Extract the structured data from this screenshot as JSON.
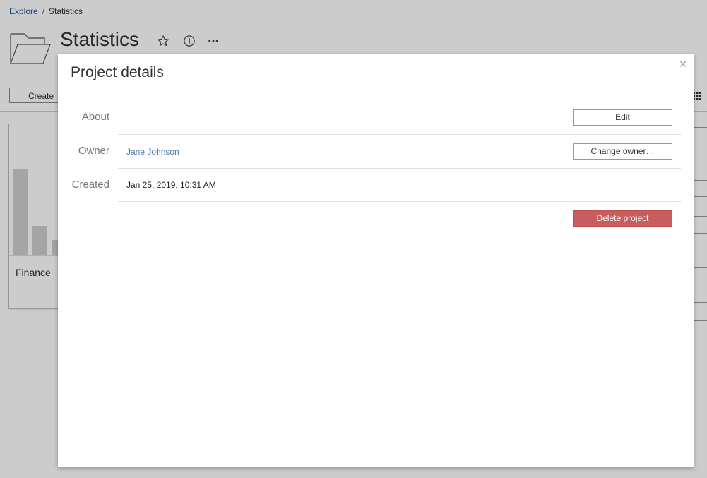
{
  "breadcrumb": {
    "root": "Explore",
    "separator": "/",
    "current": "Statistics"
  },
  "page": {
    "title": "Statistics"
  },
  "toolbar": {
    "create_label": "Create"
  },
  "cards": [
    {
      "label": "Finance"
    }
  ],
  "modal": {
    "title": "Project details",
    "close_glyph": "×",
    "about_label": "About",
    "owner_label": "Owner",
    "owner_value": "Jane Johnson",
    "created_label": "Created",
    "created_value": "Jan 25, 2019, 10:31 AM",
    "edit_label": "Edit",
    "change_owner_label": "Change owner…",
    "delete_label": "Delete project"
  },
  "icons": {
    "favorite": "star-icon",
    "info": "info-icon",
    "more": "more-icon",
    "folder": "folder-icon",
    "close": "close-icon",
    "grid_view": "grid-view-icon"
  },
  "colors": {
    "link": "#1f5a91",
    "owner_link": "#4d7aa6",
    "danger": "#c95c5c",
    "overlay": "rgba(0,0,0,0.20)"
  }
}
